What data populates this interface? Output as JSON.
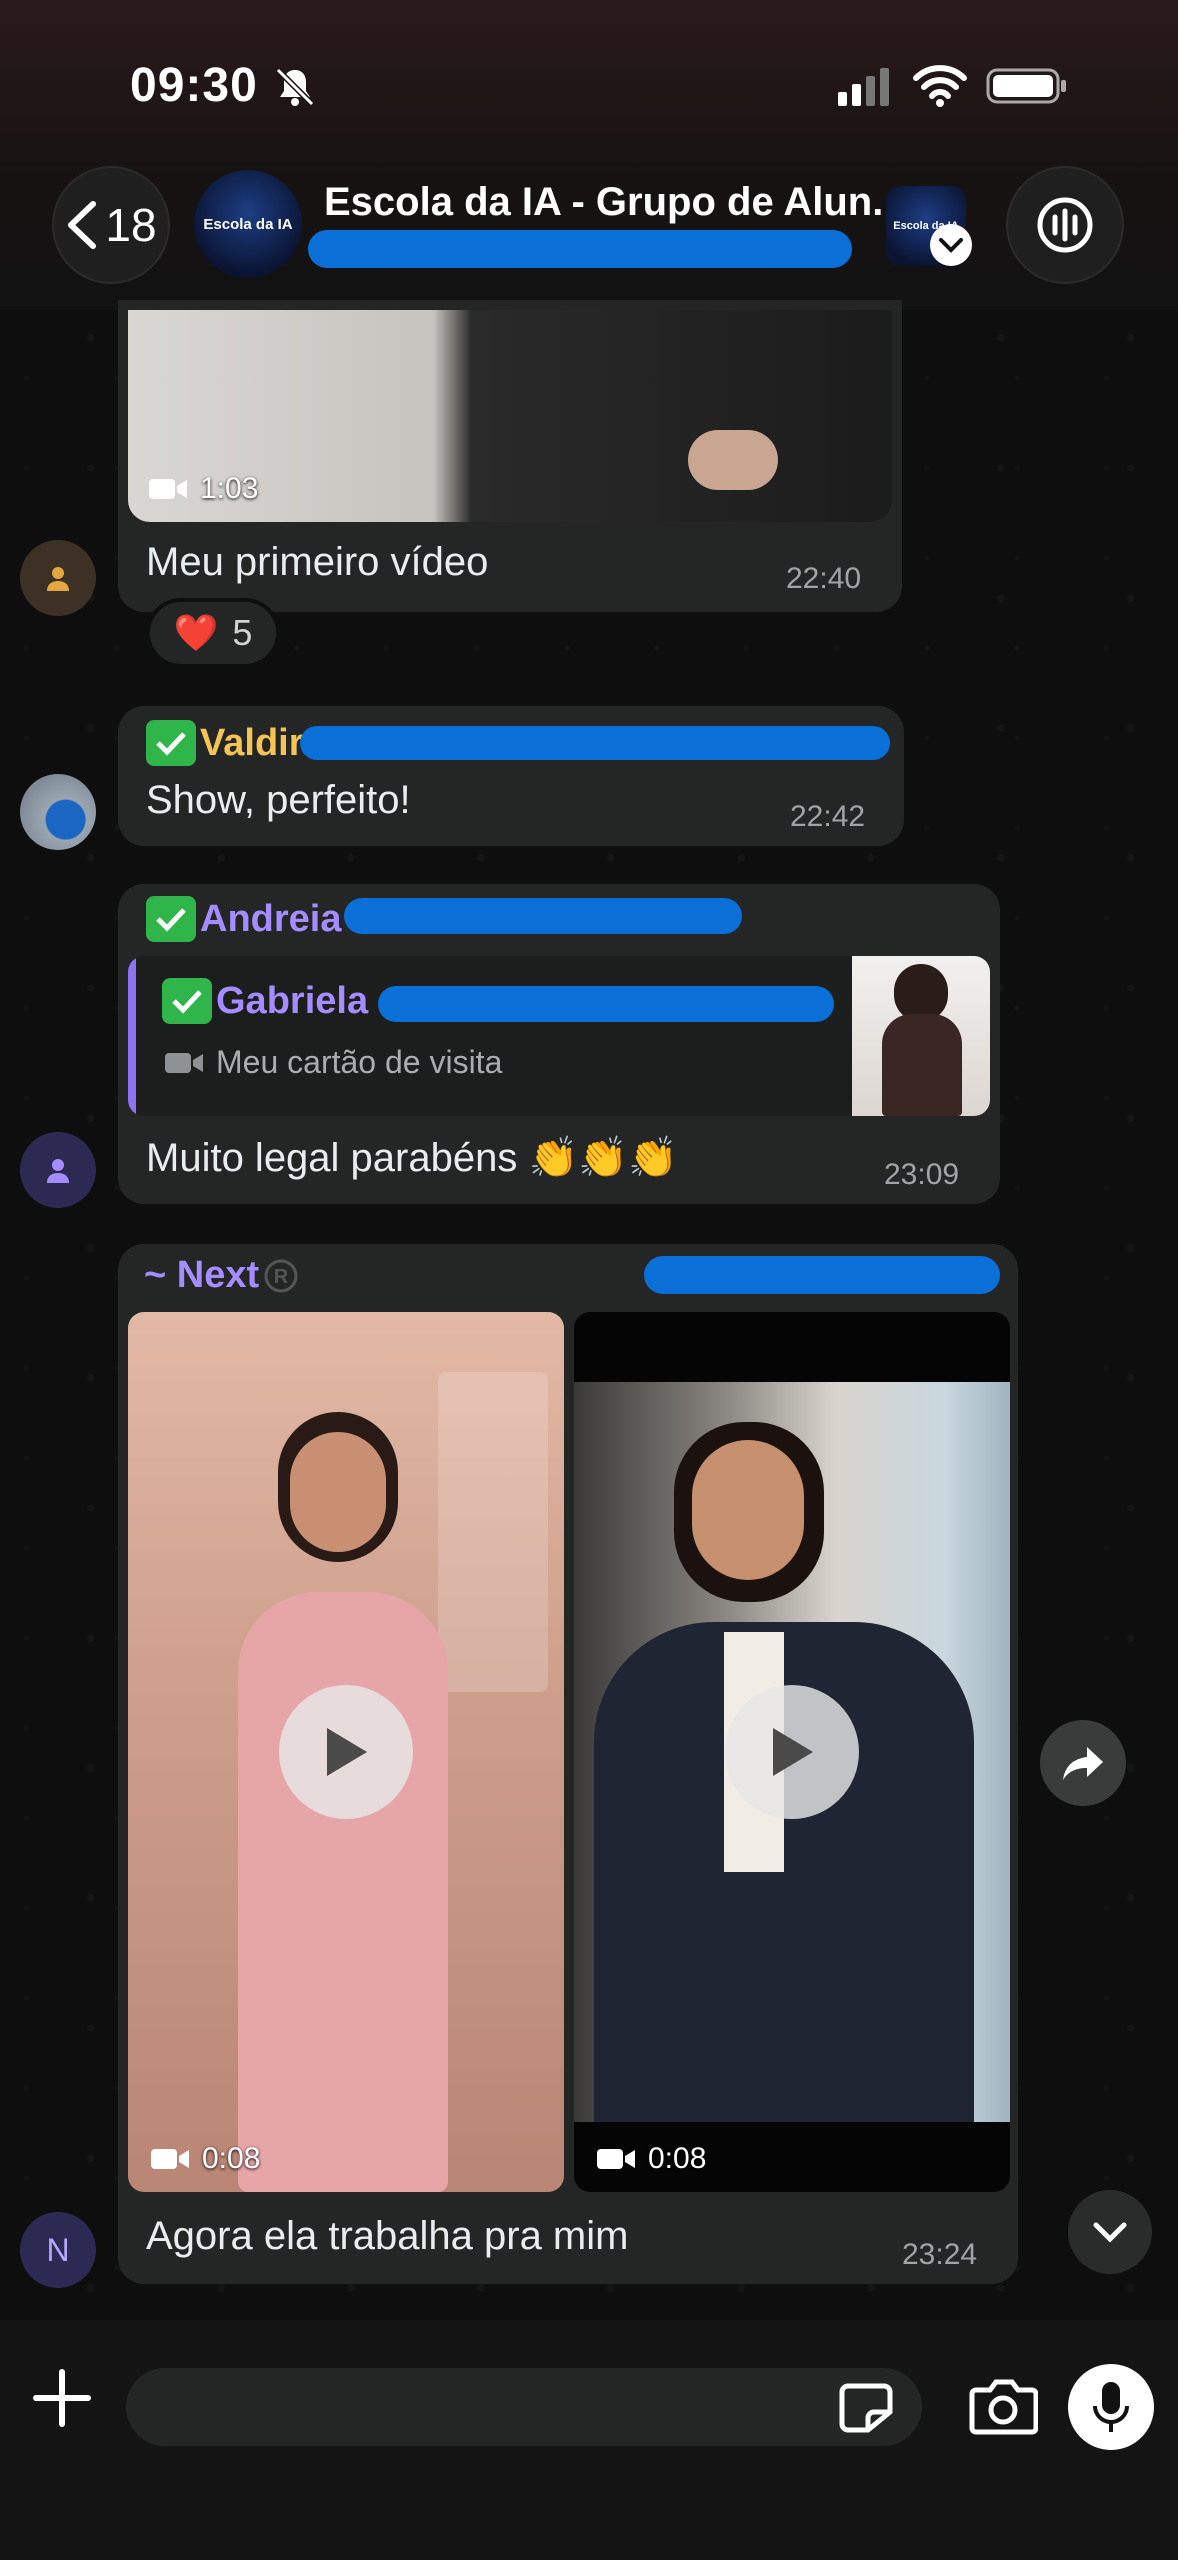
{
  "status_bar": {
    "time": "09:30"
  },
  "header": {
    "back_count": "18",
    "title": "Escola da IA - Grupo de Alun...",
    "avatar_text": "Escola da IA",
    "community_text": "Escola da IA"
  },
  "messages": [
    {
      "type": "video",
      "video_duration": "1:03",
      "text": "Meu primeiro vídeo",
      "time": "22:40",
      "reaction": {
        "emoji": "❤️",
        "count": "5"
      }
    },
    {
      "type": "text",
      "sender": "Valdir",
      "text": "Show, perfeito!",
      "time": "22:42"
    },
    {
      "type": "reply",
      "sender": "Andreia",
      "quote": {
        "sender": "Gabriela",
        "text": "Meu cartão de visita"
      },
      "text": "Muito legal parabéns 👏👏👏",
      "time": "23:09"
    },
    {
      "type": "album",
      "sender": "~ Next",
      "videos": [
        {
          "duration": "0:08"
        },
        {
          "duration": "0:08"
        }
      ],
      "text": "Agora ela trabalha pra mim",
      "time": "23:24",
      "avatar_letter": "N"
    }
  ],
  "composer": {
    "placeholder": ""
  },
  "colors": {
    "accent_sender_valdir": "#f6c453",
    "accent_sender_purple": "#a58cff",
    "redaction": "#0b6fd8",
    "bubble": "#242626"
  }
}
